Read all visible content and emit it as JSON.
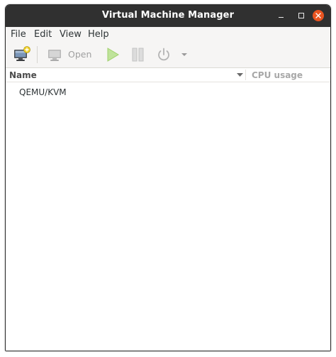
{
  "window": {
    "title": "Virtual Machine Manager"
  },
  "menubar": {
    "items": [
      "File",
      "Edit",
      "View",
      "Help"
    ]
  },
  "toolbar": {
    "new_vm_icon": "monitor-plus-icon",
    "open_label": "Open",
    "open_icon": "monitor-icon",
    "run_icon": "play-icon",
    "pause_icon": "pause-icon",
    "shutdown_icon": "power-icon",
    "dropdown_icon": "caret-down-icon"
  },
  "list": {
    "columns": [
      "Name",
      "CPU usage"
    ],
    "rows": [
      {
        "name": "QEMU/KVM"
      }
    ]
  },
  "colors": {
    "titlebar": "#303030",
    "close_button": "#e95420",
    "run_enabled": "#9fd06b",
    "disabled_text": "#a0a0a0"
  }
}
